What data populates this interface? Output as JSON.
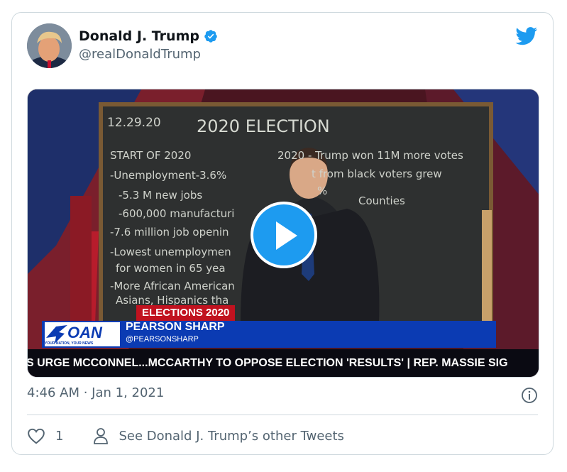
{
  "author": {
    "name": "Donald J. Trump",
    "handle": "@realDonaldTrump",
    "verified": true
  },
  "icons": {
    "verified": "verified-badge-icon",
    "logo": "twitter-bird-icon",
    "play": "play-icon",
    "info": "info-icon",
    "like": "heart-icon",
    "profile": "person-icon"
  },
  "colors": {
    "accent": "#1d9bf0",
    "text_secondary": "#536471",
    "oan_blue": "#0b3bb3",
    "elections_red": "#c1121f"
  },
  "video": {
    "chalkboard": {
      "date": "12.29.20",
      "title": "2020 ELECTION",
      "left_lines": [
        "START OF 2020",
        "-Unemployment-3.6%",
        "-5.3 M new jobs",
        "-600,000 manufacturi",
        "-7.6 million job openin",
        "-Lowest unemploymen",
        "for women in 65 yea",
        "-More African American",
        "Asians, Hispanics tha"
      ],
      "right_lines": [
        "2020 - Trump won 11M more votes",
        "t from black voters grew",
        "%",
        "Counties"
      ]
    },
    "banner_title": "ELECTIONS 2020",
    "network_logo": "OAN",
    "network_tagline": "YOUR NATION, YOUR NEWS",
    "anchor_name": "PEARSON SHARP",
    "anchor_handle": "@PEARSONSHARP",
    "crawl_text": "S URGE MCCONNEL...MCCARTHY TO OPPOSE ELECTION 'RESULTS'  |  REP. MASSIE SIG"
  },
  "timestamp": "4:46 AM · Jan 1, 2021",
  "actions": {
    "like_count": "1",
    "other_tweets_label": "See Donald J. Trump’s other Tweets"
  }
}
